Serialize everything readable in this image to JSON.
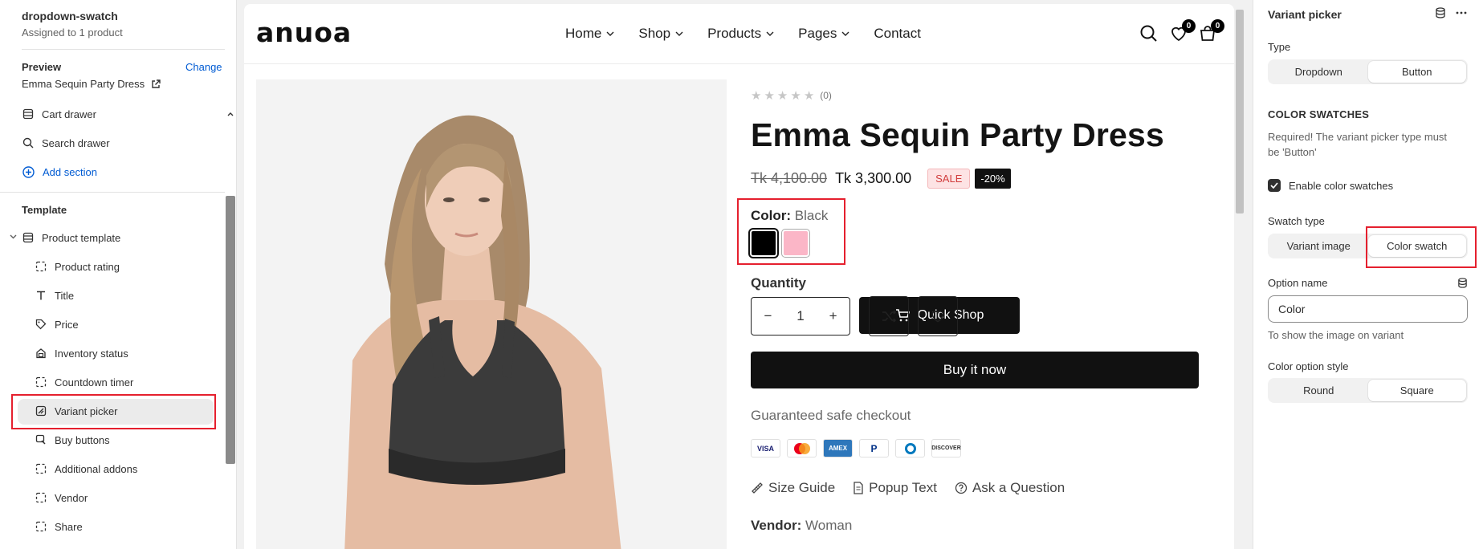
{
  "left": {
    "template_name": "dropdown-swatch",
    "assigned": "Assigned to 1 product",
    "preview_label": "Preview",
    "change_label": "Change",
    "preview_product": "Emma Sequin Party Dress",
    "sections": [
      {
        "label": "Cart drawer"
      },
      {
        "label": "Search drawer"
      }
    ],
    "add_section": "Add section",
    "template_label": "Template",
    "product_template": "Product template",
    "blocks": [
      {
        "label": "Product rating",
        "icon": "dashed-box-icon"
      },
      {
        "label": "Title",
        "icon": "text-icon"
      },
      {
        "label": "Price",
        "icon": "tag-icon"
      },
      {
        "label": "Inventory status",
        "icon": "lock-icon"
      },
      {
        "label": "Countdown timer",
        "icon": "dashed-box-icon"
      },
      {
        "label": "Variant picker",
        "icon": "variant-icon",
        "selected": true
      },
      {
        "label": "Buy buttons",
        "icon": "buy-icon"
      },
      {
        "label": "Additional addons",
        "icon": "dashed-box-icon"
      },
      {
        "label": "Vendor",
        "icon": "dashed-box-icon"
      },
      {
        "label": "Share",
        "icon": "dashed-box-icon"
      }
    ]
  },
  "store": {
    "logo": "anuoa",
    "nav": [
      "Home",
      "Shop",
      "Products",
      "Pages",
      "Contact"
    ],
    "wishlist_count": "0",
    "cart_count": "0",
    "rating_count": "(0)",
    "title": "Emma Sequin Party Dress",
    "old_price": "Tk 4,100.00",
    "new_price": "Tk 3,300.00",
    "sale_badge": "SALE",
    "discount_badge": "-20%",
    "color_label": "Color:",
    "color_value": "Black",
    "swatches": [
      {
        "name": "Black",
        "color": "#000000"
      },
      {
        "name": "Pink",
        "color": "#fbb6c7"
      }
    ],
    "quantity_label": "Quantity",
    "quantity_value": "1",
    "quick_shop": "Quick Shop",
    "buy_now": "Buy it now",
    "guarantee": "Guaranteed safe checkout",
    "payments": [
      "VISA",
      "Mastercard",
      "AMEX",
      "PayPal",
      "Diners",
      "DISCOVER"
    ],
    "links": [
      "Size Guide",
      "Popup Text",
      "Ask a Question"
    ],
    "vendor_label": "Vendor:",
    "vendor_value": "Woman"
  },
  "right": {
    "title": "Variant picker",
    "type_label": "Type",
    "type_options": [
      "Dropdown",
      "Button"
    ],
    "type_selected": "Button",
    "color_swatches_heading": "COLOR SWATCHES",
    "color_swatches_help": "Required! The variant picker type must be 'Button'",
    "enable_swatches": "Enable color swatches",
    "enable_swatches_checked": true,
    "swatch_type_label": "Swatch type",
    "swatch_type_options": [
      "Variant image",
      "Color swatch"
    ],
    "swatch_type_selected": "Color swatch",
    "option_name_label": "Option name",
    "option_name_value": "Color",
    "option_name_help": "To show the image on variant",
    "color_option_style_label": "Color option style",
    "color_option_style_options": [
      "Round",
      "Square"
    ],
    "color_option_style_selected": "Square"
  },
  "colors": {
    "accent": "#005bd3",
    "highlight": "#e5202e",
    "primary_button": "#111111"
  }
}
